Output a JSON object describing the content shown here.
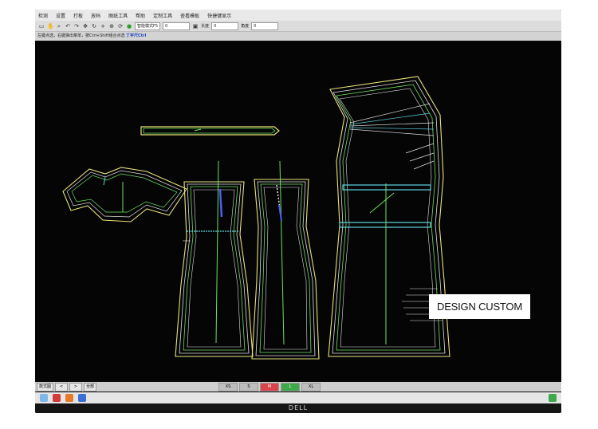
{
  "menubar": {
    "items": [
      "检测",
      "设置",
      "打板",
      "放码",
      "图纸工具",
      "帮助",
      "定制工具",
      "查看模板",
      "快捷键显示"
    ]
  },
  "toolbar": {
    "dropdown_value": "智能模式F5",
    "field_1": "0",
    "label_length": "长度",
    "field_2": "0",
    "label_angle": "角度",
    "field_3": "0"
  },
  "hintbar": {
    "text": "左键点选，右键弹出菜单，按Ctrl+Shift组合点选",
    "emphasis": "丁字尺Ctrl"
  },
  "overlay": {
    "label": "DESIGN CUSTOM"
  },
  "statusbar": {
    "tab_label": "款式图",
    "prev": "<",
    "next": ">",
    "all": "全部",
    "cells": [
      "XS",
      "S",
      "M",
      "L",
      "XL"
    ]
  },
  "bezel": {
    "brand": "DELL"
  },
  "colors": {
    "canvas": "#050506",
    "pattern_yellow": "#e8e27a",
    "pattern_green": "#6ee061",
    "pattern_white": "#e0e0e0",
    "pattern_cyan": "#5ed5e0",
    "pattern_blue": "#4a5ef0"
  }
}
